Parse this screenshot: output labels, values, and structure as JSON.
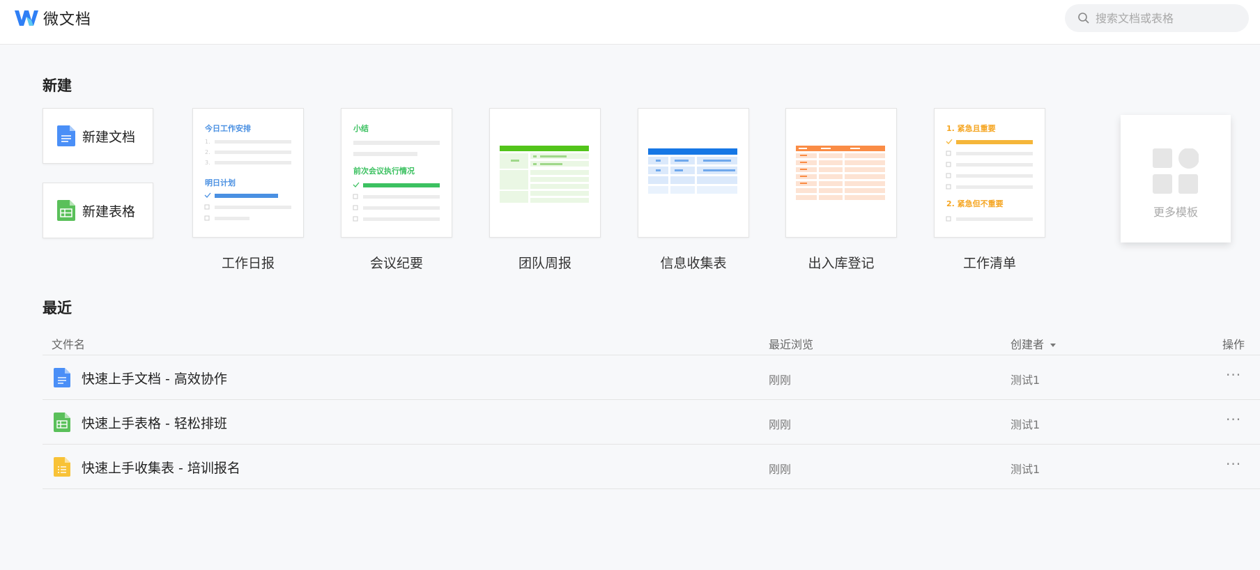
{
  "header": {
    "app_name": "微文档",
    "search_placeholder": "搜索文档或表格"
  },
  "new_section": {
    "title": "新建",
    "new_doc_label": "新建文档",
    "new_sheet_label": "新建表格",
    "templates": [
      {
        "label": "工作日报",
        "preview": {
          "heading1": "今日工作安排",
          "heading2": "明日计划",
          "accent": "#4a90e2"
        }
      },
      {
        "label": "会议纪要",
        "preview": {
          "heading1": "小结",
          "heading2": "前次会议执行情况",
          "accent": "#3cc161"
        }
      },
      {
        "label": "团队周报",
        "preview": {
          "accent": "#52c41a"
        }
      },
      {
        "label": "信息收集表",
        "preview": {
          "accent": "#1677e5"
        }
      },
      {
        "label": "出入库登记",
        "preview": {
          "accent": "#fa8c45"
        }
      },
      {
        "label": "工作清单",
        "preview": {
          "heading1": "1. 紧急且重要",
          "heading2": "2. 紧急但不重要",
          "accent": "#f5b63a"
        }
      }
    ],
    "more_templates_label": "更多模板"
  },
  "recent_section": {
    "title": "最近",
    "columns": {
      "name": "文件名",
      "viewed": "最近浏览",
      "owner": "创建者",
      "actions": "操作"
    },
    "files": [
      {
        "name": "快速上手文档 - 高效协作",
        "viewed": "刚刚",
        "owner": "测试1",
        "type": "doc"
      },
      {
        "name": "快速上手表格 - 轻松排班",
        "viewed": "刚刚",
        "owner": "测试1",
        "type": "sheet"
      },
      {
        "name": "快速上手收集表 - 培训报名",
        "viewed": "刚刚",
        "owner": "测试1",
        "type": "form"
      }
    ],
    "more_glyph": "···"
  },
  "colors": {
    "doc_blue": "#4a8ff7",
    "sheet_green": "#5ac05a",
    "form_yellow": "#f8c237",
    "logo_blue": "#2f7ff5"
  }
}
